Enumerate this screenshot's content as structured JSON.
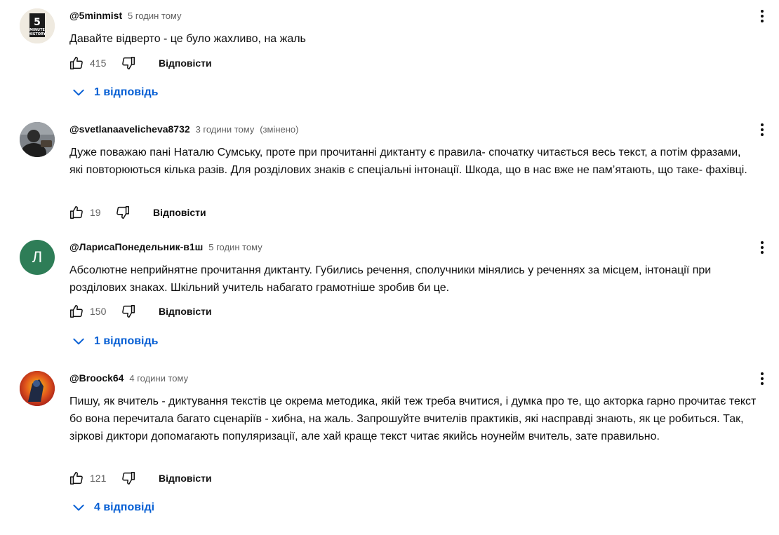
{
  "comments": [
    {
      "author": "@5minmist",
      "time": "5 годин тому",
      "text": "Давайте відверто - це було жахливо, на жаль",
      "likes": "415",
      "reply_label": "Відповісти",
      "replies_label": "1 відповідь",
      "avatar_text": [
        "5",
        "MINUTE",
        "HISTORY"
      ]
    },
    {
      "author": "@svetlanaavelicheva8732",
      "time": "3 години тому",
      "edited": "(змінено)",
      "text": "Дуже поважаю пані Наталю Сумську, проте при прочитанні диктанту є правила- спочатку читається весь текст, а потім фразами, які повторюються кілька разів. Для  розділових знаків є спеціальні інтонації. Шкода, що в нас вже не пам’ятають, що таке- фахівці.",
      "likes": "19",
      "reply_label": "Відповісти"
    },
    {
      "author": "@ЛарисаПонедельник-в1ш",
      "time": "5 годин тому",
      "text": "Абсолютне неприйнятне прочитання диктанту. Губились речення, сполучники мінялись у реченнях за місцем, інтонації при розділових знаках. Шкільний учитель набагато грамотніше зробив би це.",
      "likes": "150",
      "reply_label": "Відповісти",
      "replies_label": "1 відповідь",
      "avatar_letter": "Л",
      "avatar_color": "#2e7d57"
    },
    {
      "author": "@Broock64",
      "time": "4 години тому",
      "text": "Пишу, як вчитель - диктування текстів це окрема методика, якій теж треба вчитися, і думка про те, що акторка гарно прочитає текст бо вона перечитала багато сценаріїв - хибна, на жаль. Запрошуйте вчителів практиків, які насправді знають, як це робиться. Так, зіркові диктори допомагають популяризації, але хай краще текст читає якийсь ноунейм вчитель, зате правильно.",
      "likes": "121",
      "reply_label": "Відповісти",
      "replies_label": "4 відповіді"
    }
  ],
  "colors": {
    "link_blue": "#065fd4",
    "meta_gray": "#606060",
    "text": "#0f0f0f"
  },
  "icons": [
    "thumbs-up-icon",
    "thumbs-down-icon",
    "more-vert-icon",
    "chevron-down-icon"
  ]
}
